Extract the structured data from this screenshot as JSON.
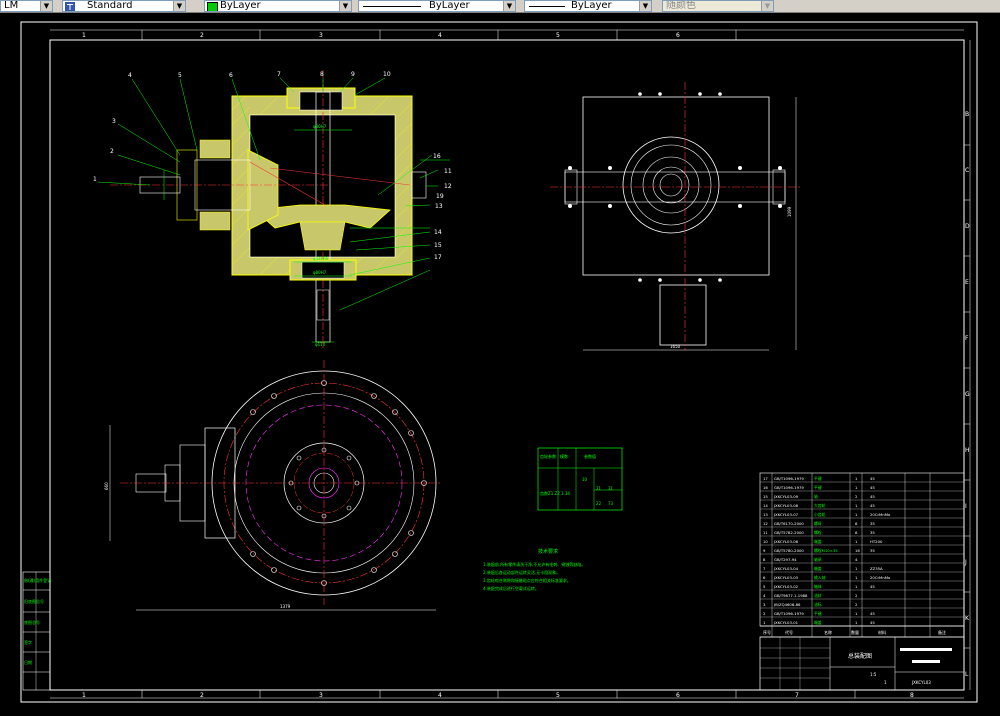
{
  "toolbar": {
    "dimstyle_value": "LM",
    "textstyle_value": "Standard",
    "layer_value": "ByLayer",
    "linetype_value": "ByLayer",
    "lineweight_value": "ByLayer",
    "color_value": "随颜色",
    "colors": {
      "layer_swatch": "#00cc00",
      "text_icon": "#3355aa"
    }
  },
  "drawing": {
    "col_labels": [
      "1",
      "2",
      "3",
      "4",
      "5",
      "6",
      "1",
      "2",
      "3",
      "4",
      "5",
      "6",
      "7",
      "8"
    ],
    "row_labels_right": [
      "B",
      "C",
      "D",
      "E",
      "F",
      "G",
      "H",
      "I",
      "J",
      "K",
      "L"
    ],
    "balloons": [
      "1",
      "2",
      "3",
      "4",
      "5",
      "6",
      "7",
      "8",
      "9",
      "10",
      "11",
      "12",
      "13",
      "14",
      "15",
      "16",
      "17",
      "18",
      "19"
    ],
    "dims": {
      "overall_width": "1379",
      "side_height": "1099",
      "side_width": "1650",
      "top_height": "660",
      "shaft_dia": "φ110"
    },
    "gear_table": {
      "header_left": "齿轮参数",
      "header_mid": "模数",
      "header_right": "参数值",
      "row_a": "齿数Z1 Z2",
      "row_b": "3.34",
      "cell_10": "10",
      "cell_21": "21",
      "cell_31": "31",
      "cell_22": "22",
      "cell_73": "73"
    },
    "tech_req": {
      "title": "技术要求",
      "lines": [
        "1.装配前,所有零件清洗干净,不允许有毛刺、锈蚀等缺陷。",
        "2.装配后各运动部件运转灵活,无卡阻现象。",
        "3.齿轮啮合侧隙和接触斑点应符合相关标准要求。",
        "4.装配完成后进行空载试运转。"
      ]
    },
    "bom_rows": [
      {
        "no": "17",
        "code": "GB/T1096-1979",
        "name": "平键",
        "qty": "1",
        "mat": "45"
      },
      {
        "no": "16",
        "code": "GB/T1096-1979",
        "name": "平键",
        "qty": "1",
        "mat": "45"
      },
      {
        "no": "15",
        "code": "JXKCYL03-09",
        "name": "轴",
        "qty": "2",
        "mat": "45"
      },
      {
        "no": "14",
        "code": "JXKCYL03-08",
        "name": "大齿轮",
        "qty": "1",
        "mat": "45"
      },
      {
        "no": "13",
        "code": "JXKCYL03-07",
        "name": "小齿轮",
        "qty": "1",
        "mat": "20CrMnMo"
      },
      {
        "no": "12",
        "code": "GB/T6170-2000",
        "name": "螺母",
        "qty": "8",
        "mat": "35"
      },
      {
        "no": "11",
        "code": "GB/T5782-2000",
        "name": "螺栓",
        "qty": "8",
        "mat": "35"
      },
      {
        "no": "10",
        "code": "JXKCYL03-06",
        "name": "端盖",
        "qty": "1",
        "mat": "HT200"
      },
      {
        "no": "9",
        "code": "GB/T5780-2000",
        "name": "螺栓M10×35",
        "qty": "16",
        "mat": "35"
      },
      {
        "no": "8",
        "code": "GB/T297-94",
        "name": "轴承",
        "qty": "4",
        "mat": ""
      },
      {
        "no": "7",
        "code": "JXKCYL03-04",
        "name": "箱盖",
        "qty": "1",
        "mat": "ZZ35A"
      },
      {
        "no": "6",
        "code": "JXKCYL03-03",
        "name": "输入轴",
        "qty": "1",
        "mat": "20CrMnMo"
      },
      {
        "no": "5",
        "code": "JXKCYL03-02",
        "name": "箱体",
        "qty": "1",
        "mat": "45"
      },
      {
        "no": "4",
        "code": "GB/T9877.1-1988",
        "name": "油封",
        "qty": "2",
        "mat": ""
      },
      {
        "no": "3",
        "code": "JB/ZQ4606-86",
        "name": "油标",
        "qty": "2",
        "mat": ""
      },
      {
        "no": "2",
        "code": "GB/T1096-1979",
        "name": "平键",
        "qty": "1",
        "mat": "45"
      },
      {
        "no": "1",
        "code": "JXKCYL03-01",
        "name": "端盖",
        "qty": "1",
        "mat": "45"
      }
    ],
    "bom_header": [
      "序号",
      "代号",
      "名称",
      "数量",
      "材料",
      "备注"
    ],
    "title_block": {
      "drawing_name": "总装配图",
      "drawing_no": "JXKCYL03",
      "scale": "1:5",
      "sheet": "1"
    },
    "left_stamp": [
      "借(通)用件登记",
      "旧底图总号",
      "底图总号",
      "签字",
      "日期"
    ]
  }
}
